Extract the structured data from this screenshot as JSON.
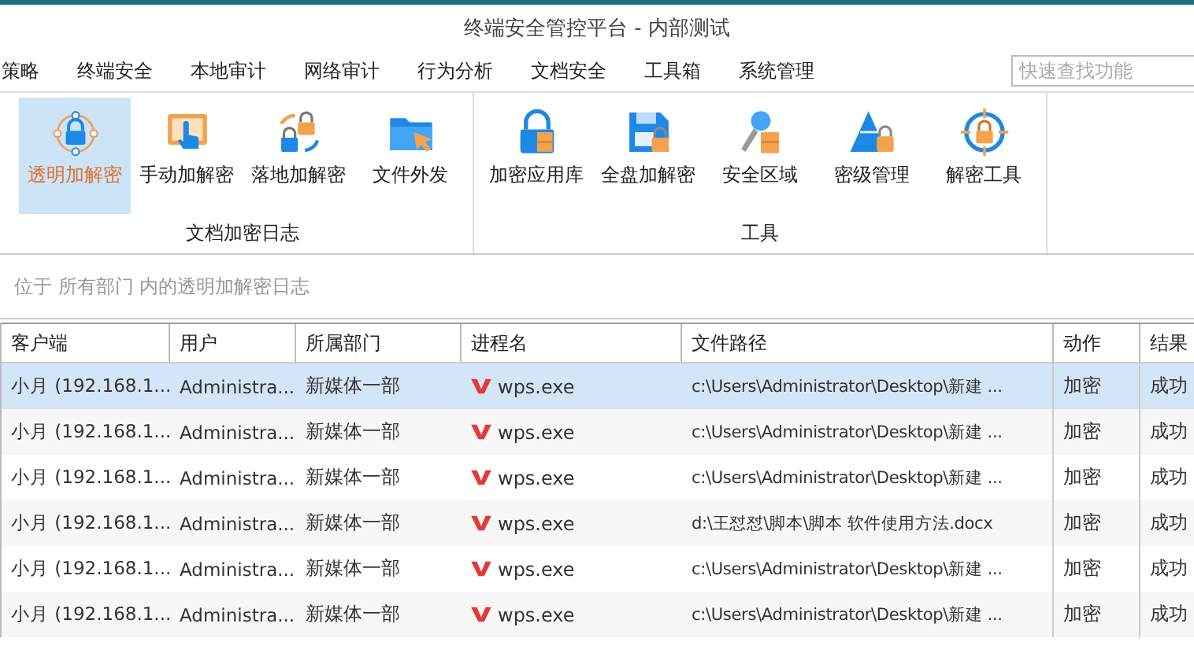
{
  "window": {
    "title": "终端安全管控平台 - 内部测试"
  },
  "menu": {
    "items": [
      "策略",
      "终端安全",
      "本地审计",
      "网络审计",
      "行为分析",
      "文档安全",
      "工具箱",
      "系统管理"
    ],
    "search": {
      "placeholder": "快速查找功能"
    }
  },
  "ribbon": {
    "groups": [
      {
        "label": "文档加密日志",
        "items": [
          {
            "label": "透明加解密",
            "kind": "ring-lock",
            "selected": true
          },
          {
            "label": "手动加解密",
            "kind": "touch",
            "selected": false
          },
          {
            "label": "落地加解密",
            "kind": "lock-swap",
            "selected": false
          },
          {
            "label": "文件外发",
            "kind": "folder-send",
            "selected": false
          }
        ]
      },
      {
        "label": "工具",
        "items": [
          {
            "label": "加密应用库",
            "kind": "lock-cabinet",
            "selected": false
          },
          {
            "label": "全盘加解密",
            "kind": "disk-lock",
            "selected": false
          },
          {
            "label": "安全区域",
            "kind": "key-cabinet",
            "selected": false
          },
          {
            "label": "密级管理",
            "kind": "pyramid-lock",
            "selected": false
          },
          {
            "label": "解密工具",
            "kind": "target-lock",
            "selected": false
          }
        ]
      }
    ]
  },
  "breadcrumb": "位于 所有部门 内的透明加解密日志",
  "table": {
    "columns": [
      "客户端",
      "用户",
      "所属部门",
      "进程名",
      "文件路径",
      "动作",
      "结果"
    ],
    "rows": [
      {
        "selected": true,
        "cells": [
          "小月 (192.168.1...",
          "Administra...",
          "新媒体一部",
          "wps.exe",
          "c:\\Users\\Administrator\\Desktop\\新建 ...",
          "加密",
          "成功"
        ]
      },
      {
        "selected": false,
        "cells": [
          "小月 (192.168.1...",
          "Administra...",
          "新媒体一部",
          "wps.exe",
          "c:\\Users\\Administrator\\Desktop\\新建 ...",
          "加密",
          "成功"
        ]
      },
      {
        "selected": false,
        "cells": [
          "小月 (192.168.1...",
          "Administra...",
          "新媒体一部",
          "wps.exe",
          "c:\\Users\\Administrator\\Desktop\\新建 ...",
          "加密",
          "成功"
        ]
      },
      {
        "selected": false,
        "cells": [
          "小月 (192.168.1...",
          "Administra...",
          "新媒体一部",
          "wps.exe",
          "d:\\王怼怼\\脚本\\脚本 软件使用方法.docx",
          "加密",
          "成功"
        ]
      },
      {
        "selected": false,
        "cells": [
          "小月 (192.168.1...",
          "Administra...",
          "新媒体一部",
          "wps.exe",
          "c:\\Users\\Administrator\\Desktop\\新建 ...",
          "加密",
          "成功"
        ]
      },
      {
        "selected": false,
        "cells": [
          "小月 (192.168.1...",
          "Administra...",
          "新媒体一部",
          "wps.exe",
          "c:\\Users\\Administrator\\Desktop\\新建 ...",
          "加密",
          "成功"
        ]
      }
    ]
  }
}
